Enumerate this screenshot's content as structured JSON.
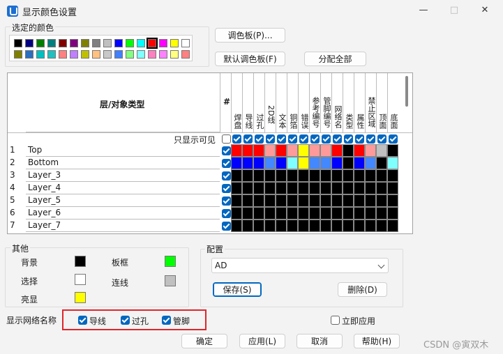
{
  "window": {
    "title": "显示颜色设置",
    "min_icon": "minimize-icon",
    "max_icon": "maximize-icon",
    "close_icon": "close-icon"
  },
  "selected_colors": {
    "title": "选定的颜色",
    "swatches": [
      "#000000",
      "#000080",
      "#008000",
      "#008080",
      "#800000",
      "#800080",
      "#808000",
      "#808080",
      "#c0c0c0",
      "#0000ff",
      "#00ff00",
      "#00ffff",
      "#ff0000",
      "#ff00ff",
      "#ffff00",
      "#ffffff",
      "#808000",
      "#2a6fc0",
      "#00c0c0",
      "#20c0c0",
      "#ff8080",
      "#c080ff",
      "#c0c000",
      "#ffc080",
      "#c8c8c8",
      "#4080ff",
      "#80ff80",
      "#80ffff",
      "#ff80c0",
      "#ff80ff",
      "#ffff80",
      "#ff8080"
    ],
    "selected_index": 12
  },
  "buttons": {
    "palette": "调色板(P)...",
    "default_palette": "默认调色板(F)",
    "assign_all": "分配全部",
    "save": "保存(S)",
    "delete": "删除(D)",
    "ok": "确定",
    "apply": "应用(L)",
    "cancel": "取消",
    "help": "帮助(H)"
  },
  "grid": {
    "header_layer_type": "层/对象类型",
    "header_hash": "#",
    "only_visible_label": "只显示可见",
    "columns": [
      "焊盘",
      "导线",
      "过孔",
      "2D线",
      "文本",
      "铜箔",
      "错误",
      "参考编号",
      "管脚编号",
      "网络名",
      "类型",
      "属性",
      "禁止区域",
      "顶面",
      "底面"
    ],
    "rows": [
      {
        "index": "1",
        "name": "Top",
        "colors": [
          "#ff0000",
          "#ff0000",
          "#ff0000",
          "#ff9a9a",
          "#ff0000",
          "#ff9a9a",
          "#ffff00",
          "#ff9a9a",
          "#ff9a9a",
          "#ff0000",
          "#000000",
          "#ff0000",
          "#ff9a9a",
          "#c0c0c0",
          "#000000"
        ]
      },
      {
        "index": "2",
        "name": "Bottom",
        "colors": [
          "#0000ff",
          "#0000ff",
          "#0000ff",
          "#4488ff",
          "#0000ff",
          "#80ffff",
          "#ffff00",
          "#4488ff",
          "#4488ff",
          "#0000ff",
          "#000000",
          "#0000ff",
          "#4488ff",
          "#000000",
          "#80ffff"
        ]
      },
      {
        "index": "3",
        "name": "Layer_3"
      },
      {
        "index": "4",
        "name": "Layer_4"
      },
      {
        "index": "5",
        "name": "Layer_5"
      },
      {
        "index": "6",
        "name": "Layer_6"
      },
      {
        "index": "7",
        "name": "Layer_7"
      }
    ]
  },
  "other": {
    "title": "其他",
    "background": {
      "label": "背景",
      "color": "#000000"
    },
    "board_frame": {
      "label": "板框",
      "color": "#00ff00"
    },
    "selection": {
      "label": "选择",
      "color": "#ffffff"
    },
    "connection": {
      "label": "连线",
      "color": "#c0c0c0"
    },
    "highlight": {
      "label": "亮显",
      "color": "#ffff00"
    }
  },
  "config": {
    "title": "配置",
    "selected": "AD"
  },
  "net_names": {
    "label": "显示网络名称",
    "options": [
      "导线",
      "过孔",
      "管脚"
    ]
  },
  "apply_now": "立即应用",
  "watermark": "CSDN @寅双木"
}
